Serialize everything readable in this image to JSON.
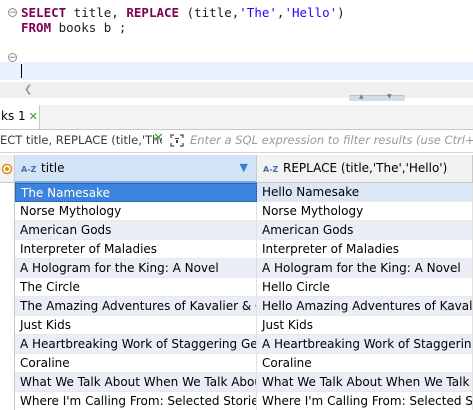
{
  "editor": {
    "line1": {
      "kw1": "SELECT",
      "t1": " title, ",
      "kw2": "REPLACE",
      "t2": " (title,",
      "s1": "'The'",
      "t3": ",",
      "s2": "'Hello'",
      "t4": ")"
    },
    "line2": {
      "kw1": "FROM",
      "t1": " books b ;"
    }
  },
  "results_tab": {
    "label": "ks 1",
    "close": "✕"
  },
  "filter": {
    "query": "ECT title, REPLACE (title,'The','H",
    "clear": "✕",
    "placeholder": "Enter a SQL expression to filter results (use Ctrl+Space)"
  },
  "grid": {
    "columns": [
      {
        "label": "title",
        "sort_icon": "A-Z"
      },
      {
        "label": "REPLACE (title,'The','Hello')",
        "sort_icon": "A-Z"
      }
    ],
    "rows": [
      [
        "The Namesake",
        "Hello Namesake"
      ],
      [
        "Norse Mythology",
        "Norse Mythology"
      ],
      [
        "American Gods",
        "American Gods"
      ],
      [
        "Interpreter of Maladies",
        "Interpreter of Maladies"
      ],
      [
        "A Hologram for the King: A Novel",
        "A Hologram for the King: A Novel"
      ],
      [
        "The Circle",
        "Hello Circle"
      ],
      [
        "The Amazing Adventures of Kavalier & Clay",
        "Hello Amazing Adventures of Kavalier & Clay"
      ],
      [
        "Just Kids",
        "Just Kids"
      ],
      [
        "A Heartbreaking Work of Staggering Genius",
        "A Heartbreaking Work of Staggering Genius"
      ],
      [
        "Coraline",
        "Coraline"
      ],
      [
        "What We Talk About When We Talk About Love",
        "What We Talk About When We Talk About Love"
      ],
      [
        "Where I'm Calling From: Selected Stories",
        "Where I'm Calling From: Selected Stories"
      ]
    ]
  }
}
